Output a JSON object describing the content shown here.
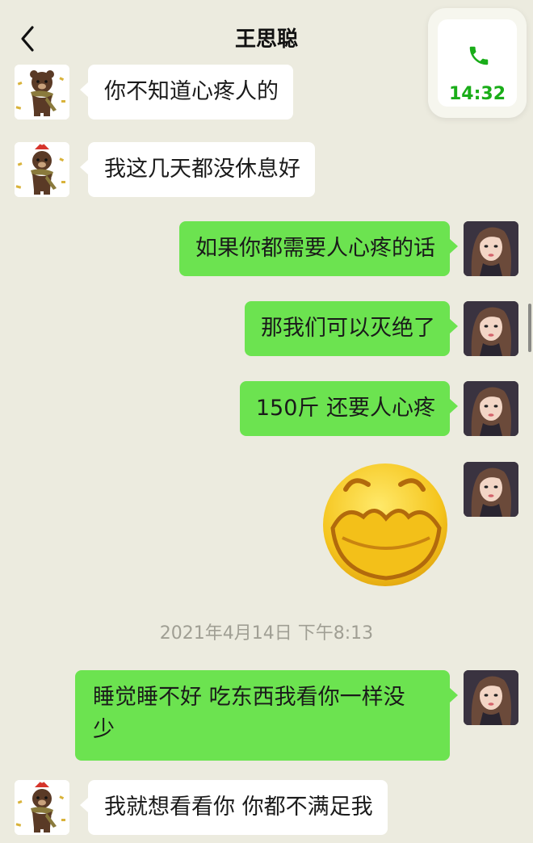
{
  "header": {
    "title": "王思聪",
    "call_time": "14:32",
    "back_icon": "chevron-left-icon",
    "call_icon": "phone-icon",
    "accent_color": "#1aad19"
  },
  "messages": [
    {
      "sender": "contact",
      "avatar": "bear-avatar",
      "text": "你不知道心疼人的"
    },
    {
      "sender": "contact",
      "avatar": "bear-avatar",
      "text": "我这几天都没休息好"
    },
    {
      "sender": "me",
      "avatar": "girl-avatar",
      "text": "如果你都需要人心疼的话"
    },
    {
      "sender": "me",
      "avatar": "girl-avatar",
      "text": "那我们可以灭绝了"
    },
    {
      "sender": "me",
      "avatar": "girl-avatar",
      "text": "150斤 还要人心疼"
    },
    {
      "sender": "me",
      "avatar": "girl-avatar",
      "sticker": "laughing-face-sticker"
    },
    {
      "timestamp": "2021年4月14日 下午8:13"
    },
    {
      "sender": "me",
      "avatar": "girl-avatar",
      "text_line1": "睡觉睡不好 吃东西我看你一样没",
      "text_line2": "少"
    },
    {
      "sender": "contact",
      "avatar": "bear-avatar",
      "text": "我就想看看你 你都不满足我"
    }
  ],
  "colors": {
    "background": "#ecebdf",
    "incoming_bubble": "#ffffff",
    "outgoing_bubble": "#6ce350"
  }
}
